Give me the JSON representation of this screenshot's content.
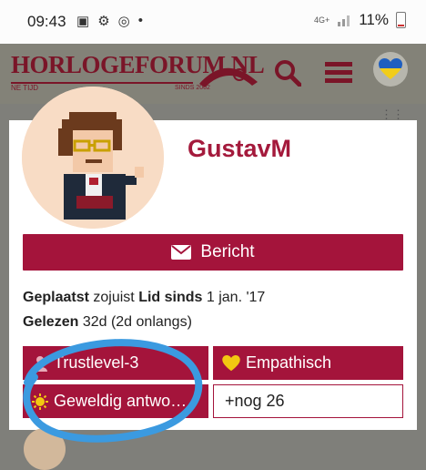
{
  "status_bar": {
    "time": "09:43",
    "network": "4G+",
    "battery": "11%"
  },
  "header": {
    "logo_title": "HORLOGEFORUM.NL",
    "logo_subtitle": "NE    TIJD",
    "logo_since": "SINDS 2002",
    "icons": [
      "search-icon",
      "hamburger-menu-icon",
      "ukraine-heart-icon"
    ]
  },
  "profile": {
    "username": "GustavM",
    "message_button": "Bericht",
    "posted_label": "Geplaatst",
    "posted_value": "zojuist",
    "member_since_label": "Lid sinds",
    "member_since_value": "1 jan. '17",
    "read_label": "Gelezen",
    "read_value": "32d (2d onlangs)",
    "badges": [
      {
        "label": "Trustlevel-3",
        "icon": "user-icon"
      },
      {
        "label": "Empathisch",
        "icon": "heart-icon"
      },
      {
        "label": "Geweldig antwo…",
        "icon": "sun-badge-icon"
      },
      {
        "label": "+nog 26"
      }
    ]
  },
  "colors": {
    "accent": "#a4143b",
    "overlay_bg": "#7f7f7a",
    "annotation_circle": "#3b9ae0"
  }
}
